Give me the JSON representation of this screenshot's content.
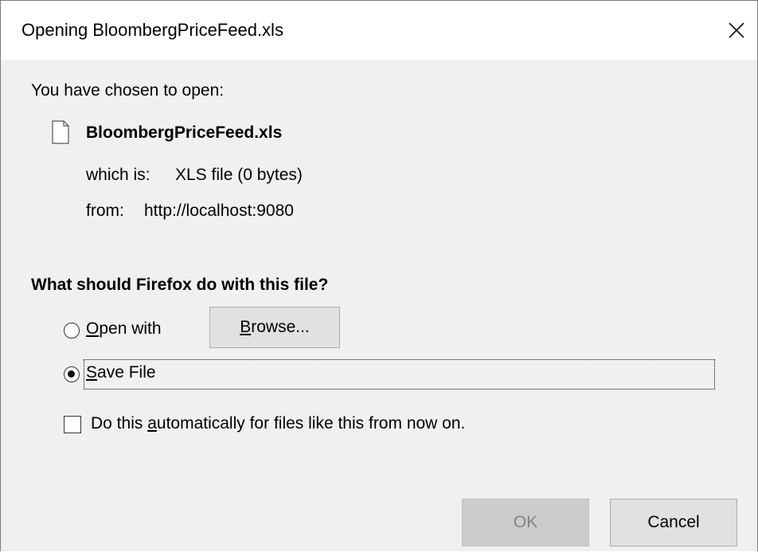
{
  "dialog": {
    "title": "Opening BloombergPriceFeed.xls",
    "close_glyph": "✕"
  },
  "info": {
    "intro": "You have chosen to open:",
    "file_name": "BloombergPriceFeed.xls",
    "which_is_label": "which is:",
    "which_is_value": "XLS file (0 bytes)",
    "from_label": "from:",
    "from_value": "http://localhost:9080"
  },
  "question": "What should Firefox do with this file?",
  "options": {
    "open_with": {
      "accesskey": "O",
      "rest": "pen with",
      "checked": false
    },
    "browse_button": {
      "accesskey": "B",
      "rest": "rowse..."
    },
    "save_file": {
      "accesskey": "S",
      "rest": "ave File",
      "checked": true
    },
    "auto": {
      "before": "Do this ",
      "accesskey": "a",
      "after": "utomatically for files like this from now on.",
      "checked": false
    }
  },
  "buttons": {
    "ok": "OK",
    "cancel": "Cancel"
  },
  "icons": {
    "file": "file-icon",
    "close": "close-icon"
  }
}
